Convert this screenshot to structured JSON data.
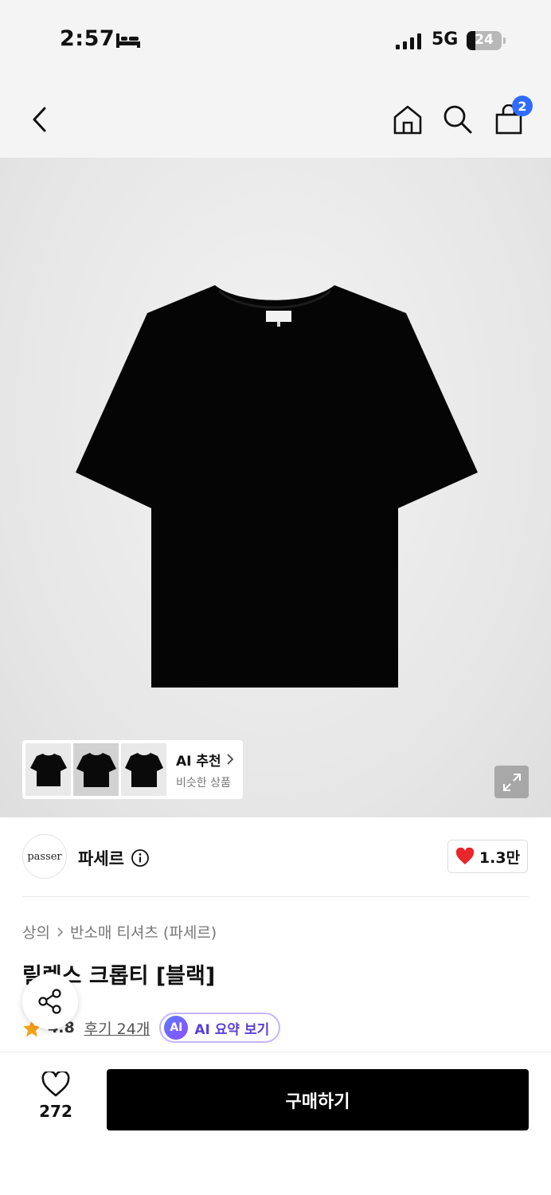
{
  "status_bar": {
    "time": "2:57",
    "network": "5G",
    "battery_level": "24",
    "battery_fraction": 0.24
  },
  "nav": {
    "back_icon": "chevron-left-icon",
    "home_icon": "home-icon",
    "search_icon": "search-icon",
    "cart_icon": "shopping-bag-icon",
    "cart_count": "2"
  },
  "hero": {
    "ai_recommend": {
      "title": "AI 추천",
      "subtitle": "비슷한 상품"
    }
  },
  "brand": {
    "logo_text": "passer",
    "name": "파세르",
    "likes": "1.3만"
  },
  "product": {
    "breadcrumb": [
      "상의",
      "반소매 티셔츠 (파세르)"
    ],
    "title": "릴렉스 크롭티 [블랙]",
    "rating": "4.8",
    "reviews": "후기 24개",
    "ai_chip": "AI",
    "ai_summary": "AI 요약 보기"
  },
  "bottom_bar": {
    "wish_count": "272",
    "buy_label": "구매하기"
  },
  "colors": {
    "badge_blue": "#2f6bff",
    "heart_red": "#e8262b",
    "star_orange": "#f7a21b",
    "ai_purple": "#5b3fd6",
    "buy_black": "#000000"
  }
}
